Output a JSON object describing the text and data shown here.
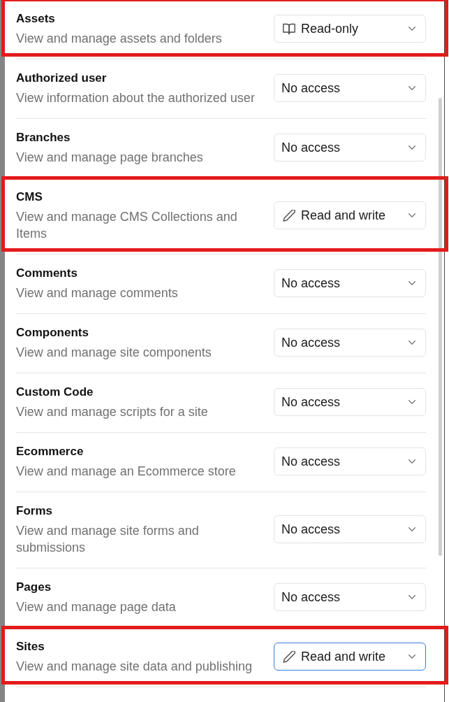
{
  "permissions": [
    {
      "title": "Assets",
      "description": "View and manage assets and folders",
      "highlighted": true,
      "select": {
        "kind": "read",
        "value": "Read-only",
        "focused": false
      }
    },
    {
      "title": "Authorized user",
      "description": "View information about the authorized user",
      "highlighted": false,
      "select": {
        "kind": "none",
        "value": "No access",
        "focused": false
      }
    },
    {
      "title": "Branches",
      "description": "View and manage page branches",
      "highlighted": false,
      "select": {
        "kind": "none",
        "value": "No access",
        "focused": false
      }
    },
    {
      "title": "CMS",
      "description": "View and manage CMS Collections and Items",
      "highlighted": true,
      "select": {
        "kind": "write",
        "value": "Read and write",
        "focused": false
      }
    },
    {
      "title": "Comments",
      "description": "View and manage comments",
      "highlighted": false,
      "select": {
        "kind": "none",
        "value": "No access",
        "focused": false
      }
    },
    {
      "title": "Components",
      "description": "View and manage site components",
      "highlighted": false,
      "select": {
        "kind": "none",
        "value": "No access",
        "focused": false
      }
    },
    {
      "title": "Custom Code",
      "description": "View and manage scripts for a site",
      "highlighted": false,
      "select": {
        "kind": "none",
        "value": "No access",
        "focused": false
      }
    },
    {
      "title": "Ecommerce",
      "description": "View and manage an Ecommerce store",
      "highlighted": false,
      "select": {
        "kind": "none",
        "value": "No access",
        "focused": false
      }
    },
    {
      "title": "Forms",
      "description": "View and manage site forms and submissions",
      "highlighted": false,
      "select": {
        "kind": "none",
        "value": "No access",
        "focused": false
      }
    },
    {
      "title": "Pages",
      "description": "View and manage page data",
      "highlighted": false,
      "select": {
        "kind": "none",
        "value": "No access",
        "focused": false
      }
    },
    {
      "title": "Sites",
      "description": "View and manage site data and publishing",
      "highlighted": true,
      "select": {
        "kind": "write",
        "value": "Read and write",
        "focused": true
      }
    }
  ]
}
